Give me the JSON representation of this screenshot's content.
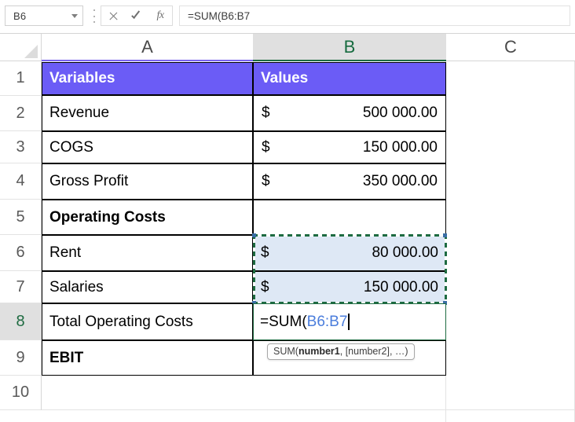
{
  "formula_bar": {
    "name_box_value": "B6",
    "name_box_caret_icon": "chevron-down-icon",
    "cancel_icon": "close-icon",
    "enter_icon": "check-icon",
    "insert_function_icon": "fx-icon",
    "formula_value": "=SUM(B6:B7"
  },
  "columns": [
    {
      "label": "A",
      "selected": false
    },
    {
      "label": "B",
      "selected": true
    },
    {
      "label": "C",
      "selected": false
    }
  ],
  "rows": [
    {
      "num": "1",
      "selected": false
    },
    {
      "num": "2",
      "selected": false
    },
    {
      "num": "3",
      "selected": false
    },
    {
      "num": "4",
      "selected": false
    },
    {
      "num": "5",
      "selected": false
    },
    {
      "num": "6",
      "selected": false
    },
    {
      "num": "7",
      "selected": false
    },
    {
      "num": "8",
      "selected": true
    },
    {
      "num": "9",
      "selected": false
    },
    {
      "num": "10",
      "selected": false
    }
  ],
  "sheet": {
    "header": {
      "a": "Variables",
      "b": "Values"
    },
    "r2": {
      "a": "Revenue",
      "cur": "$",
      "amt": "500 000.00"
    },
    "r3": {
      "a": "COGS",
      "cur": "$",
      "amt": "150 000.00"
    },
    "r4": {
      "a": "Gross Profit",
      "cur": "$",
      "amt": "350 000.00"
    },
    "r5": {
      "a": "Operating Costs",
      "b": ""
    },
    "r6": {
      "a": "Rent",
      "cur": "$",
      "amt": "80 000.00"
    },
    "r7": {
      "a": "Salaries",
      "cur": "$",
      "amt": "150 000.00"
    },
    "r8": {
      "a": "Total Operating Costs",
      "formula_fn": "=SUM(",
      "formula_ref": "B6:B7"
    },
    "r9": {
      "a": "EBIT",
      "b": ""
    }
  },
  "tooltip": {
    "prefix": "SUM(",
    "arg1": "number1",
    "suffix": ", [number2], …)"
  },
  "colors": {
    "header_fill": "#6b5cf6",
    "header_text": "#ffffff",
    "selection_green": "#1e6b41",
    "copy_range_fill": "#dee8f5",
    "formula_ref_blue": "#4a7ddc",
    "row_header_selected_fill": "#e0e0e0"
  }
}
